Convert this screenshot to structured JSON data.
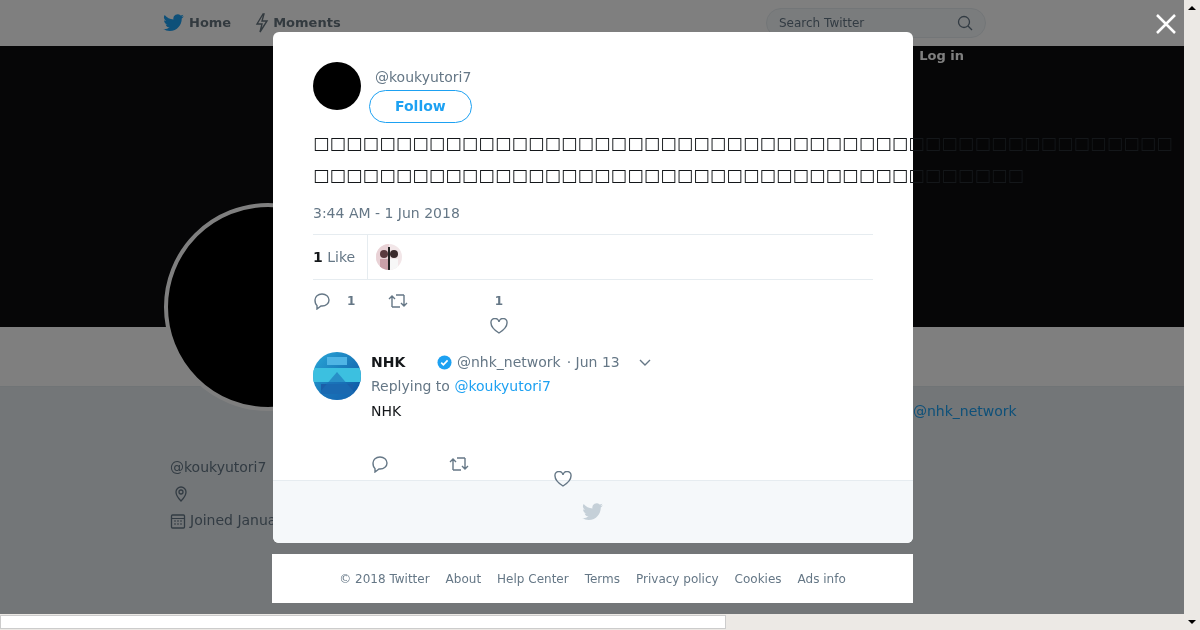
{
  "nav": {
    "items": [
      {
        "label": "Home",
        "kind": "home"
      },
      {
        "label": "Moments",
        "kind": "moments"
      }
    ],
    "search": {
      "placeholder": "Search Twitter"
    },
    "login": "Log in"
  },
  "profile": {
    "handle": "@koukyutori7",
    "joined": "Joined Janua",
    "side_link": "@nhk_network"
  },
  "tweet": {
    "handle": "@koukyutori7",
    "follow": "Follow",
    "text_lines": [
      "□□□□□□□□□□□□□□□□□□□□□□□□□□□□□□□□□□□□□□□□□□□□□□□□□□□□",
      "□□□□□□□□□□□□□□□□□□□□□□□□□□□□□□□□□□□□□□□□□□□"
    ],
    "timestamp": "3:44 AM - 1 Jun 2018",
    "likes_count": "1",
    "likes_label": "Like",
    "reply_count": "1",
    "like_count": "1"
  },
  "reply": {
    "name": "NHK",
    "verified": true,
    "handle": "@nhk_network",
    "date": "· Jun 13",
    "replying_prefix": "Replying to",
    "replying_to": "@koukyutori7",
    "text": "NHK"
  },
  "footer": {
    "links": [
      "© 2018 Twitter",
      "About",
      "Help Center",
      "Terms",
      "Privacy policy",
      "Cookies",
      "Ads info"
    ]
  }
}
